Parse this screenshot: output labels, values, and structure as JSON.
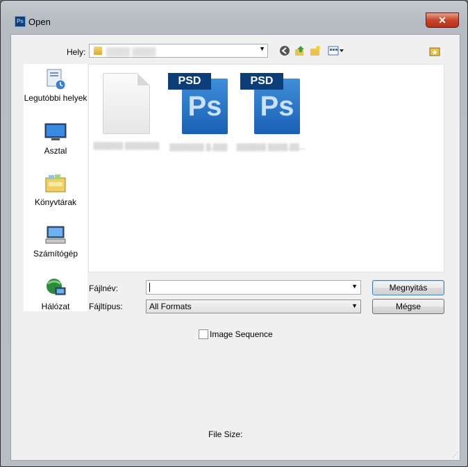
{
  "window": {
    "title": "Open",
    "app_icon_text": "Ps",
    "close_glyph": "✕"
  },
  "location": {
    "label": "Hely:",
    "value": "▒▒▒▒ ▒▒▒▒",
    "icons": [
      "back-icon",
      "up-folder-icon",
      "new-folder-icon",
      "view-menu-icon"
    ]
  },
  "places": [
    {
      "label": "Legutóbbi helyek",
      "icon": "recent-places-icon"
    },
    {
      "label": "Asztal",
      "icon": "desktop-icon"
    },
    {
      "label": "Könyvtárak",
      "icon": "libraries-icon"
    },
    {
      "label": "Számítógép",
      "icon": "computer-icon"
    },
    {
      "label": "Hálózat",
      "icon": "network-icon"
    }
  ],
  "files": [
    {
      "name": "▒▒▒▒▒▒ ▒▒▒▒▒▒▒",
      "type": "blank"
    },
    {
      "name": "▒▒▒▒▒▒▒ ▒.▒▒▒",
      "type": "psd",
      "tag": "PSD",
      "glyph": "Ps"
    },
    {
      "name": "▒▒▒▒▒▒ ▒▒▒▒.▒▒...",
      "type": "psd",
      "tag": "PSD",
      "glyph": "Ps"
    }
  ],
  "form": {
    "filename_label": "Fájlnév:",
    "filename_value": "",
    "filetype_label": "Fájltípus:",
    "filetype_value": "All Formats",
    "open_button": "Megnyitás",
    "cancel_button": "Mégse"
  },
  "image_sequence": {
    "label": "Image Sequence",
    "checked": false
  },
  "file_size_label": "File Size:"
}
